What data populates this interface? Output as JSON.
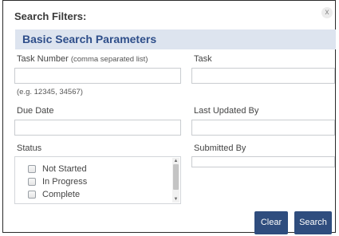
{
  "dialog": {
    "title": "Search Filters:",
    "close_label": "x"
  },
  "section": {
    "title": "Basic Search Parameters"
  },
  "fields": {
    "task_number": {
      "label": "Task Number",
      "sublabel": "(comma separated list)",
      "value": "",
      "hint": "(e.g. 12345, 34567)"
    },
    "task": {
      "label": "Task",
      "value": ""
    },
    "due_date": {
      "label": "Due Date",
      "value": ""
    },
    "last_updated_by": {
      "label": "Last Updated By",
      "value": ""
    },
    "status": {
      "label": "Status",
      "options": [
        {
          "label": "Not Started",
          "checked": false
        },
        {
          "label": "In Progress",
          "checked": false
        },
        {
          "label": "Complete",
          "checked": false
        }
      ]
    },
    "submitted_by": {
      "label": "Submitted By",
      "value": ""
    }
  },
  "buttons": {
    "clear": "Clear",
    "search": "Search"
  },
  "colors": {
    "section_bg": "#dde4ef",
    "section_text": "#2e4e8a",
    "button_bg": "#2f4d7e"
  }
}
